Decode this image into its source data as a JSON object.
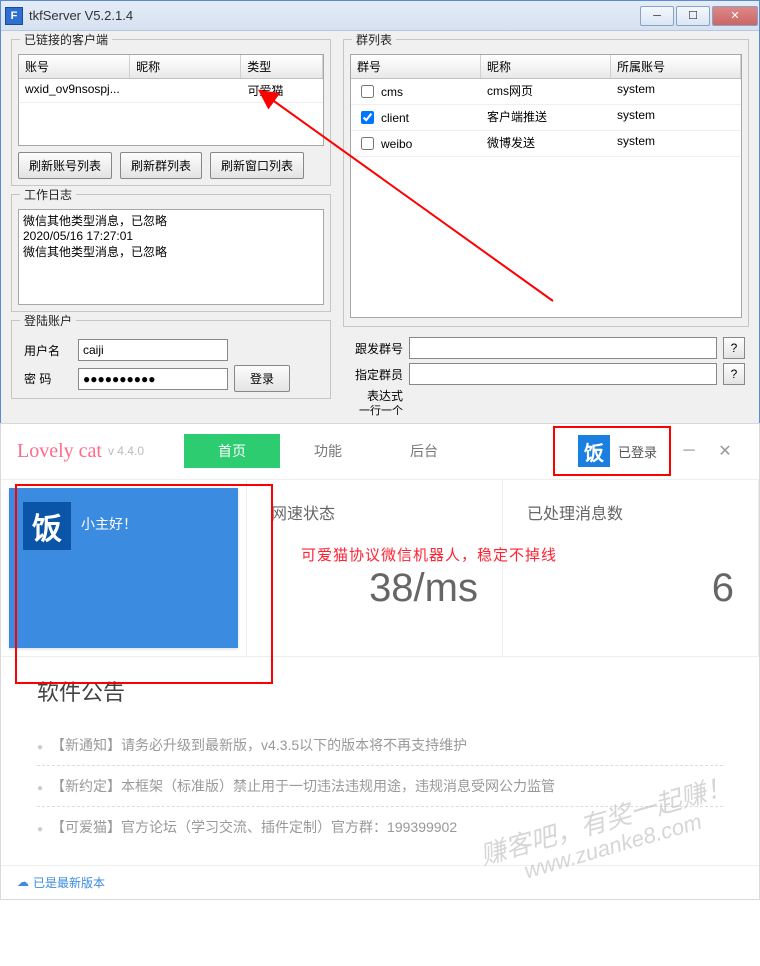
{
  "tkf": {
    "title": "tkfServer  V5.2.1.4",
    "groups": {
      "clients_title": "已链接的客户端",
      "groups_title": "群列表",
      "log_title": "工作日志",
      "login_title": "登陆账户"
    },
    "client_headers": [
      "账号",
      "昵称",
      "类型"
    ],
    "client_rows": [
      {
        "account": "wxid_ov9nsospj...",
        "nick": "",
        "type": "可爱猫"
      }
    ],
    "group_headers": [
      "群号",
      "昵称",
      "所属账号"
    ],
    "group_rows": [
      {
        "checked": false,
        "id": "cms",
        "nick": "cms网页",
        "owner": "system"
      },
      {
        "checked": true,
        "id": "client",
        "nick": "客户端推送",
        "owner": "system"
      },
      {
        "checked": false,
        "id": "weibo",
        "nick": "微博发送",
        "owner": "system"
      }
    ],
    "buttons": {
      "refresh_accounts": "刷新账号列表",
      "refresh_groups": "刷新群列表",
      "refresh_windows": "刷新窗口列表",
      "login": "登录"
    },
    "log_lines": [
      "微信其他类型消息，已忽略",
      "2020/05/16 17:27:01",
      "微信其他类型消息，已忽略"
    ],
    "login": {
      "user_label": "用户名",
      "pass_label": "密 码",
      "user_value": "caiji",
      "pass_value": "●●●●●●●●●●"
    },
    "right_labels": {
      "follow_group": "跟发群号",
      "assign_member": "指定群员",
      "expr_line1": "表达式",
      "expr_line2": "一行一个"
    }
  },
  "lc": {
    "brand": "Lovely cat",
    "version": "v 4.4.0",
    "tabs": {
      "home": "首页",
      "func": "功能",
      "backend": "后台"
    },
    "logged_in": "已登录",
    "fan_glyph": "饭",
    "greeting": "小主好！",
    "card_net": "网速状态",
    "card_net_val": "38/ms",
    "card_msg": "已处理消息数",
    "card_msg_val": "6",
    "note": "可爱猫协议微信机器人，稳定不掉线",
    "notice_title": "软件公告",
    "notice_items": [
      "【新通知】请务必升级到最新版，v4.3.5以下的版本将不再支持维护",
      "【新约定】本框架（标准版）禁止用于一切违法违规用途，违规消息受网公力监管",
      "【可爱猫】官方论坛（学习交流、插件定制）官方群：199399902"
    ],
    "footer": "已是最新版本",
    "watermark_l1": "赚客吧，有奖一起赚！",
    "watermark_l2": "www.zuanke8.com"
  }
}
